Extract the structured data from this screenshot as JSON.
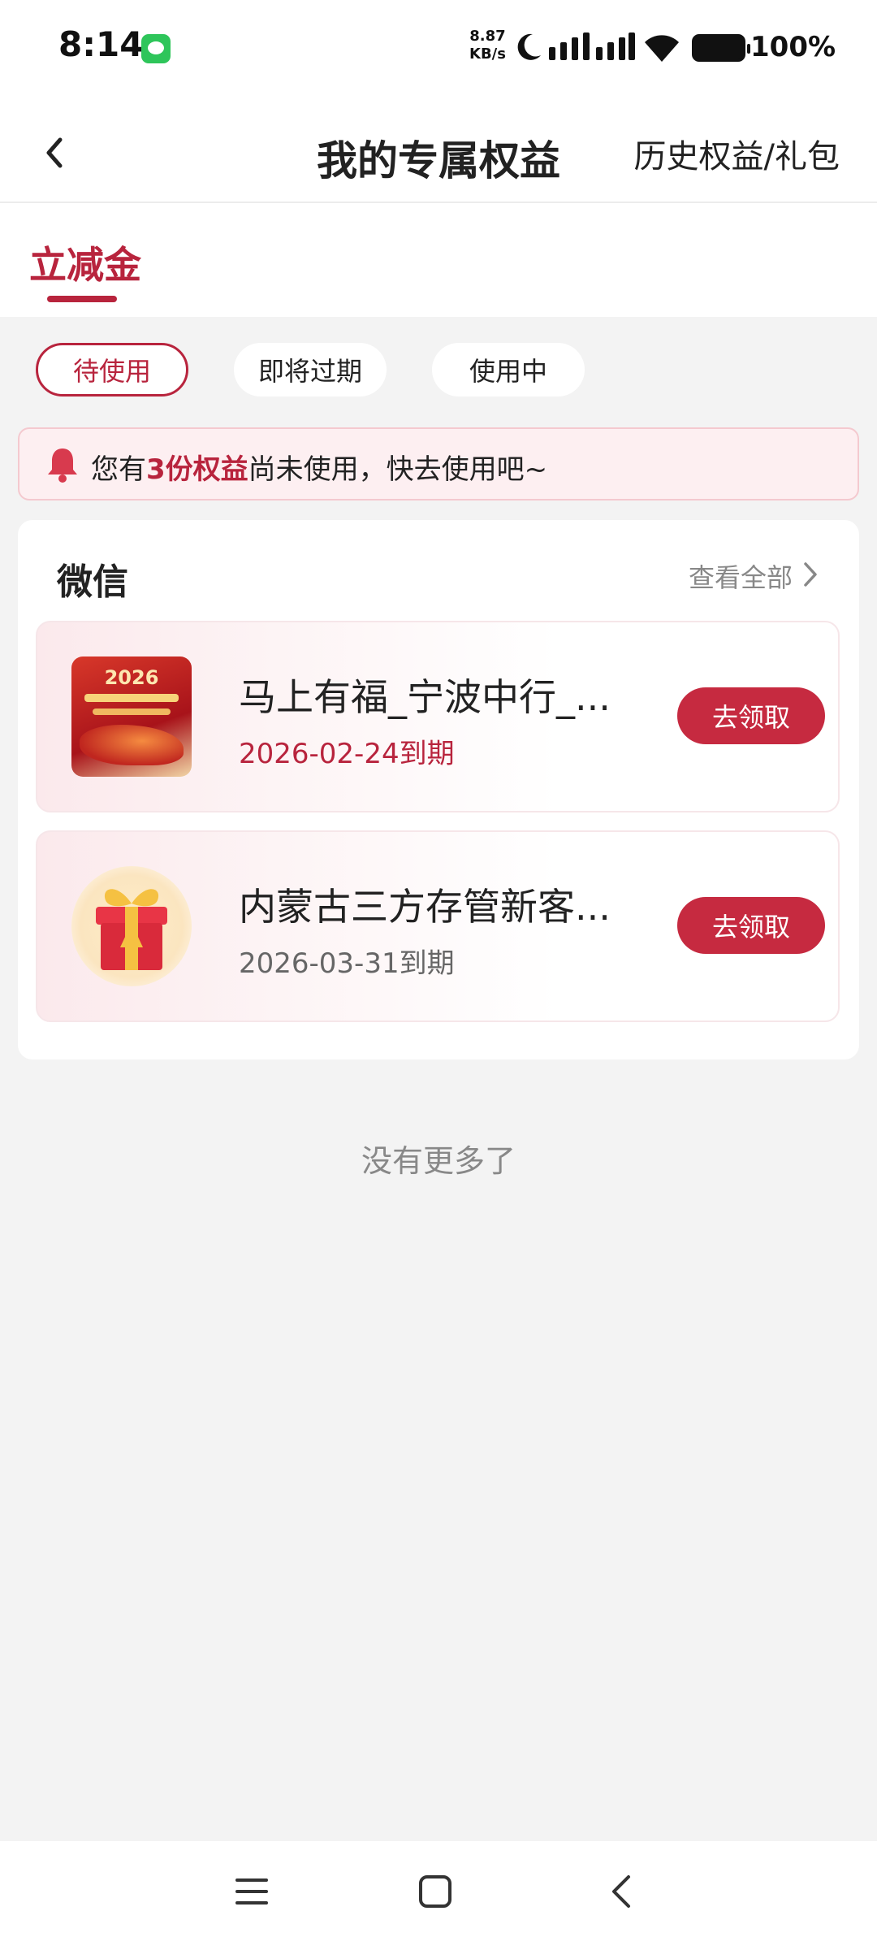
{
  "status_bar": {
    "time": "8:14",
    "net_speed_value": "8.87",
    "net_speed_unit": "KB/s",
    "battery": "100%"
  },
  "header": {
    "title": "我的专属权益",
    "history_link": "历史权益/礼包"
  },
  "tabs": {
    "active": "立减金"
  },
  "filters": [
    {
      "label": "待使用",
      "active": true
    },
    {
      "label": "即将过期",
      "active": false
    },
    {
      "label": "使用中",
      "active": false
    }
  ],
  "notice": {
    "prefix": "您有",
    "highlight": "3份权益",
    "suffix": "尚未使用，快去使用吧~"
  },
  "section": {
    "title": "微信",
    "view_all": "查看全部"
  },
  "benefits": [
    {
      "title": "马上有福_宁波中行_...",
      "expiry": "2026-02-24到期",
      "expiry_color": "#b8243d",
      "button": "去领取",
      "thumb_icon": "promo-poster-image",
      "poster_year": "2026"
    },
    {
      "title": "内蒙古三方存管新客...",
      "expiry": "2026-03-31到期",
      "expiry_color": "#666666",
      "button": "去领取",
      "thumb_icon": "gift-box-icon"
    }
  ],
  "footer": {
    "no_more": "没有更多了"
  },
  "colors": {
    "accent": "#b8243d",
    "button": "#c62a40",
    "background": "#f3f3f3"
  }
}
